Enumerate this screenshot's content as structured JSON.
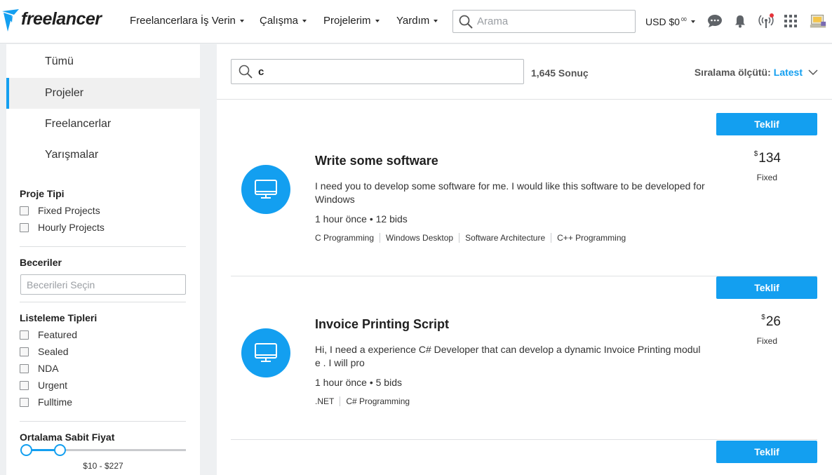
{
  "header": {
    "logo_text": "freelancer",
    "nav": [
      {
        "label": "Freelancerlara İş Verin"
      },
      {
        "label": "Çalışma"
      },
      {
        "label": "Projelerim"
      },
      {
        "label": "Yardım"
      }
    ],
    "search_placeholder": "Arama",
    "currency": "USD $0",
    "currency_cents": "00"
  },
  "sidebar": {
    "tabs": [
      {
        "label": "Tümü"
      },
      {
        "label": "Projeler"
      },
      {
        "label": "Freelancerlar"
      },
      {
        "label": "Yarışmalar"
      }
    ],
    "project_type": {
      "title": "Proje Tipi",
      "options": [
        "Fixed Projects",
        "Hourly Projects"
      ]
    },
    "skills": {
      "title": "Beceriler",
      "placeholder": "Becerileri Seçin"
    },
    "listing_types": {
      "title": "Listeleme Tipleri",
      "options": [
        "Featured",
        "Sealed",
        "NDA",
        "Urgent",
        "Fulltime"
      ]
    },
    "avg_price": {
      "title": "Ortalama Sabit Fiyat",
      "range": "$10 - $227"
    }
  },
  "main": {
    "search_value": "c",
    "result_count": "1,645 Sonuç",
    "sort_label": "Sıralama ölçütü:",
    "sort_value": "Latest",
    "bid_label": "Teklif",
    "projects": [
      {
        "title": "Write some software",
        "description": "I need you to develop some software for me. I would like this software to be developed for Windows",
        "meta": "1 hour önce • 12 bids",
        "tags": [
          "C Programming",
          "Windows Desktop",
          "Software Architecture",
          "C++ Programming"
        ],
        "currency": "$",
        "price": "134",
        "price_type": "Fixed"
      },
      {
        "title": "Invoice Printing Script",
        "description": "Hi, I need a experience C# Developer that can develop a dynamic Invoice Printing module . I will pro",
        "meta": "1 hour önce • 5 bids",
        "tags": [
          ".NET",
          "C# Programming"
        ],
        "currency": "$",
        "price": "26",
        "price_type": "Fixed"
      }
    ]
  },
  "colors": {
    "accent": "#139ff0",
    "notification": "#e6343b"
  }
}
